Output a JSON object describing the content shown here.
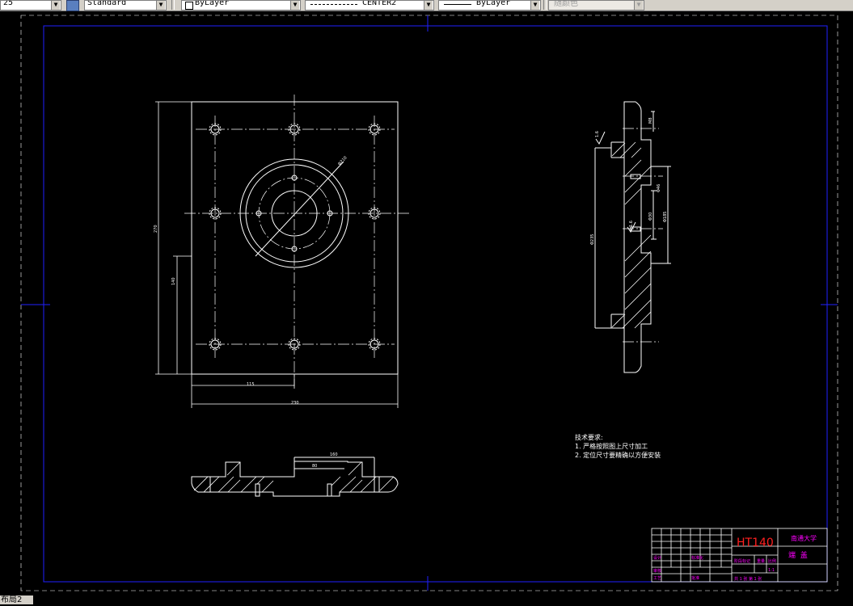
{
  "toolbar": {
    "dimscale": "25",
    "dimstyle": "Standard",
    "color": "ByLayer",
    "linetype": "CENTER2",
    "lineweight": "ByLayer",
    "plotstyle": "随颜色"
  },
  "layout_tab": "布局2",
  "drawing": {
    "dims": {
      "total_width": "230",
      "half_width": "115",
      "height": "270",
      "height2": "140",
      "diameter": "Φ210",
      "section_w1": "160",
      "section_w2": "80",
      "side1": "1.6",
      "side2": "1.6",
      "side3": "M8",
      "side4": "Φ46",
      "side5": "Φ185",
      "side6": "Φ30",
      "side7": "Φ235"
    },
    "notes": {
      "title": "技术要求:",
      "line1": "1. 严格按照图上尺寸加工",
      "line2": "2. 定位尺寸要精确以方便安装"
    },
    "title_block": {
      "material": "HT140",
      "school": "南通大学",
      "part_name": "端  盖",
      "scale_label": "比例",
      "sheet": "共 1 张  第 1 张",
      "weight": "重量",
      "drawn": "设计",
      "checked": "审核",
      "approved": "批准",
      "process": "工艺",
      "std": "标准化",
      "stage": "阶段标记",
      "qty": "1:1"
    }
  },
  "colors": {
    "frame": "#2020ff",
    "lines": "#ffffff",
    "dims": "#ffff00",
    "title_text": "#ff00ff",
    "material": "#ff2020",
    "crosshair": "#0000c0"
  }
}
